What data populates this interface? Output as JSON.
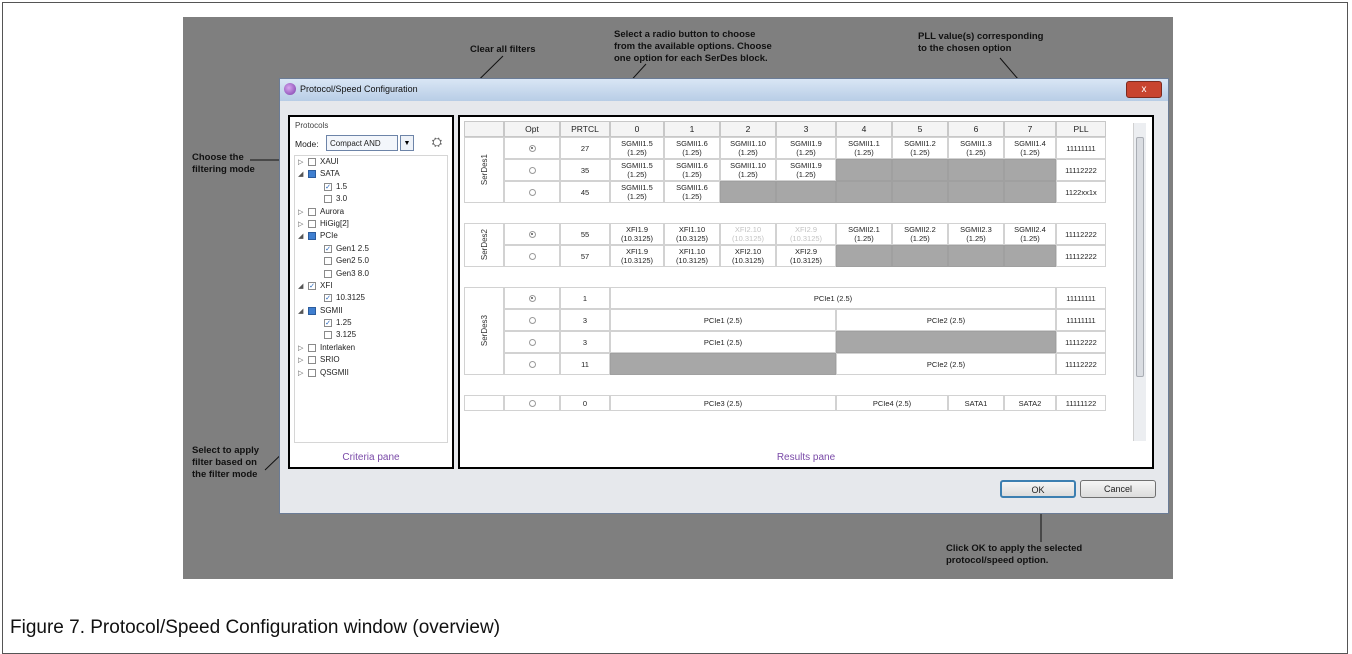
{
  "annotations": {
    "clear_filters": "Clear all filters",
    "radio_hint": "Select a radio button to choose\nfrom the available options. Choose\none option for each SerDes block.",
    "pll_hint": "PLL value(s) corresponding\nto the chosen option",
    "filter_mode": "Choose the\nfiltering mode",
    "select_apply": "Select to apply\nfilter based on\nthe filter mode",
    "ok_hint": "Click OK to apply the selected\nprotocol/speed option."
  },
  "caption": "Figure 7.  Protocol/Speed Configuration window (overview)",
  "window": {
    "title": "Protocol/Speed Configuration",
    "close_label": "x"
  },
  "criteria": {
    "heading": "Protocols",
    "mode_label": "Mode:",
    "mode_value": "Compact AND",
    "pane_label": "Criteria pane",
    "tree": [
      {
        "label": "XAUI",
        "level": 0,
        "arrow": "▷",
        "state": "unchecked"
      },
      {
        "label": "SATA",
        "level": 0,
        "arrow": "◢",
        "state": "partial"
      },
      {
        "label": "1.5",
        "level": 1,
        "arrow": "",
        "state": "checked"
      },
      {
        "label": "3.0",
        "level": 1,
        "arrow": "",
        "state": "unchecked"
      },
      {
        "label": "Aurora",
        "level": 0,
        "arrow": "▷",
        "state": "unchecked"
      },
      {
        "label": "HiGig[2]",
        "level": 0,
        "arrow": "▷",
        "state": "unchecked"
      },
      {
        "label": "PCIe",
        "level": 0,
        "arrow": "◢",
        "state": "partial"
      },
      {
        "label": "Gen1 2.5",
        "level": 1,
        "arrow": "",
        "state": "checked"
      },
      {
        "label": "Gen2 5.0",
        "level": 1,
        "arrow": "",
        "state": "unchecked"
      },
      {
        "label": "Gen3 8.0",
        "level": 1,
        "arrow": "",
        "state": "unchecked"
      },
      {
        "label": "XFI",
        "level": 0,
        "arrow": "◢",
        "state": "checked"
      },
      {
        "label": "10.3125",
        "level": 1,
        "arrow": "",
        "state": "checked"
      },
      {
        "label": "SGMII",
        "level": 0,
        "arrow": "◢",
        "state": "partial"
      },
      {
        "label": "1.25",
        "level": 1,
        "arrow": "",
        "state": "checked"
      },
      {
        "label": "3.125",
        "level": 1,
        "arrow": "",
        "state": "unchecked"
      },
      {
        "label": "Interlaken",
        "level": 0,
        "arrow": "▷",
        "state": "unchecked"
      },
      {
        "label": "SRIO",
        "level": 0,
        "arrow": "▷",
        "state": "unchecked"
      },
      {
        "label": "QSGMII",
        "level": 0,
        "arrow": "▷",
        "state": "unchecked"
      }
    ]
  },
  "results": {
    "pane_label": "Results pane",
    "columns": [
      "Opt",
      "PRTCL",
      "0",
      "1",
      "2",
      "3",
      "4",
      "5",
      "6",
      "7",
      "PLL"
    ],
    "blocks": [
      {
        "name": "SerDes1",
        "rows": [
          {
            "selected": true,
            "prtcl": "27",
            "lanes": [
              "SGMII1.5\n(1.25)",
              "SGMII1.6\n(1.25)",
              "SGMII1.10\n(1.25)",
              "SGMII1.9\n(1.25)",
              "SGMII1.1\n(1.25)",
              "SGMII1.2\n(1.25)",
              "SGMII1.3\n(1.25)",
              "SGMII1.4\n(1.25)"
            ],
            "pll": "11111111"
          },
          {
            "selected": false,
            "prtcl": "35",
            "lanes": [
              "SGMII1.5\n(1.25)",
              "SGMII1.6\n(1.25)",
              "SGMII1.10\n(1.25)",
              "SGMII1.9\n(1.25)",
              "",
              "",
              "",
              ""
            ],
            "pll": "11112222"
          },
          {
            "selected": false,
            "prtcl": "45",
            "lanes": [
              "SGMII1.5\n(1.25)",
              "SGMII1.6\n(1.25)",
              "",
              "",
              "",
              "",
              "",
              ""
            ],
            "pll": "1122xx1x"
          }
        ]
      },
      {
        "name": "SerDes2",
        "rows": [
          {
            "selected": true,
            "prtcl": "55",
            "lanes": [
              "XFI1.9\n(10.3125)",
              "XFI1.10\n(10.3125)",
              "XFI2.10\n(10.3125)",
              "XFI2.9\n(10.3125)",
              "SGMII2.1\n(1.25)",
              "SGMII2.2\n(1.25)",
              "SGMII2.3\n(1.25)",
              "SGMII2.4\n(1.25)"
            ],
            "pll": "11112222"
          },
          {
            "selected": false,
            "prtcl": "57",
            "lanes": [
              "XFI1.9\n(10.3125)",
              "XFI1.10\n(10.3125)",
              "XFI2.10\n(10.3125)",
              "XFI2.9\n(10.3125)",
              "",
              "",
              "",
              ""
            ],
            "pll": "11112222"
          }
        ]
      },
      {
        "name": "SerDes3",
        "rows": [
          {
            "selected": true,
            "prtcl": "1",
            "span_text": [
              "PCIe1 (2.5)"
            ],
            "pll": "11111111"
          },
          {
            "selected": false,
            "prtcl": "3",
            "span_text": [
              "PCIe1 (2.5)",
              "PCIe2 (2.5)"
            ],
            "pll": "11111111"
          },
          {
            "selected": false,
            "prtcl": "3",
            "span_text": [
              "PCIe1 (2.5)",
              ""
            ],
            "pll": "11112222"
          },
          {
            "selected": false,
            "prtcl": "11",
            "span_text": [
              "",
              "PCIe2 (2.5)"
            ],
            "pll": "11112222"
          }
        ]
      }
    ],
    "partial_row": {
      "prtcl": "0",
      "span_text": [
        "PCIe3 (2.5)",
        "PCIe4 (2.5)",
        "SATA1",
        "SATA2"
      ],
      "pll": "11111122"
    }
  },
  "buttons": {
    "ok": "OK",
    "cancel": "Cancel"
  }
}
